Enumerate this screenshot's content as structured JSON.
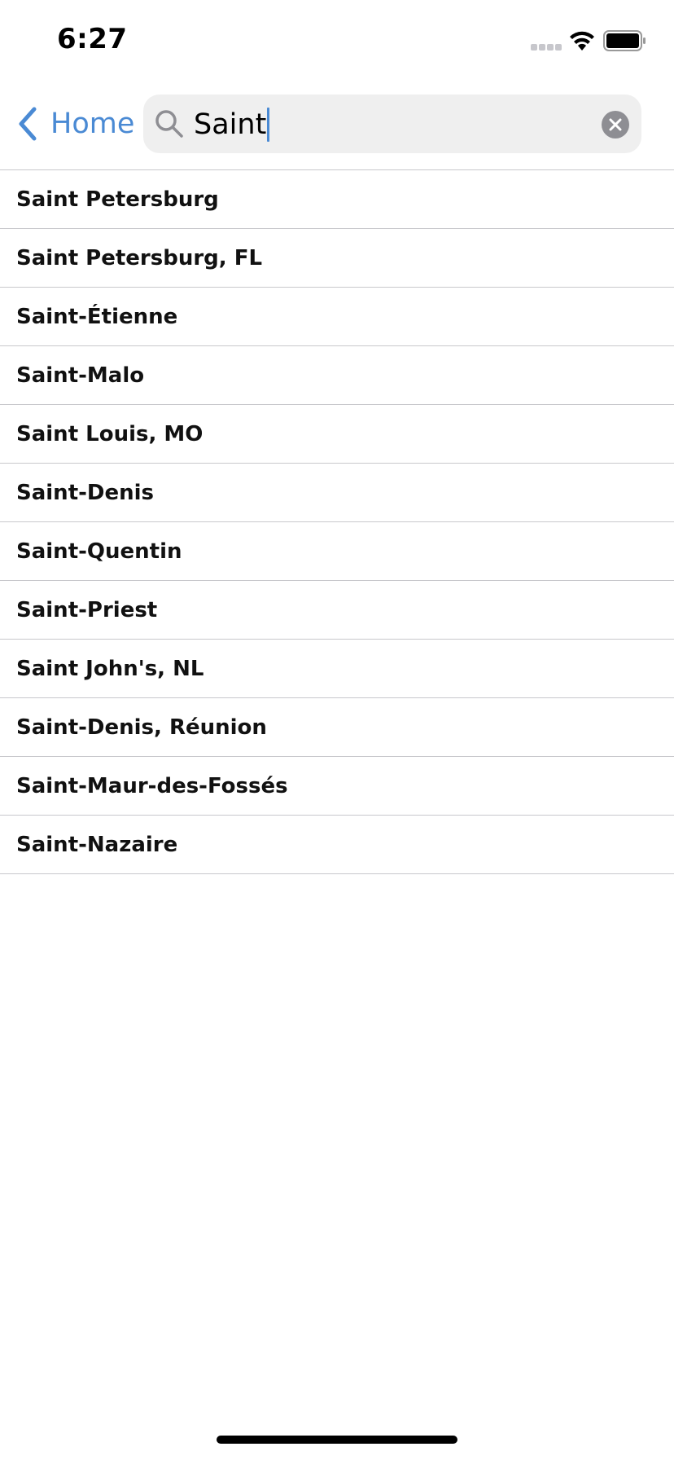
{
  "status_bar": {
    "time": "6:27",
    "icons": [
      "signal-dots-icon",
      "wifi-icon",
      "battery-icon"
    ]
  },
  "nav": {
    "back_label": "Home",
    "back_icon": "chevron-left-icon"
  },
  "search": {
    "value": "Saint",
    "icon": "search-icon",
    "clear_icon": "clear-circle-icon"
  },
  "results": [
    "Saint Petersburg",
    "Saint Petersburg, FL",
    "Saint-Étienne",
    "Saint-Malo",
    "Saint Louis, MO",
    "Saint-Denis",
    "Saint-Quentin",
    "Saint-Priest",
    "Saint John's, NL",
    "Saint-Denis, Réunion",
    "Saint-Maur-des-Fossés",
    "Saint-Nazaire"
  ],
  "colors": {
    "accent": "#4a8ad4",
    "search_background": "#efefef",
    "separator": "#c8c8cc",
    "clear_button": "#8e8e93"
  }
}
